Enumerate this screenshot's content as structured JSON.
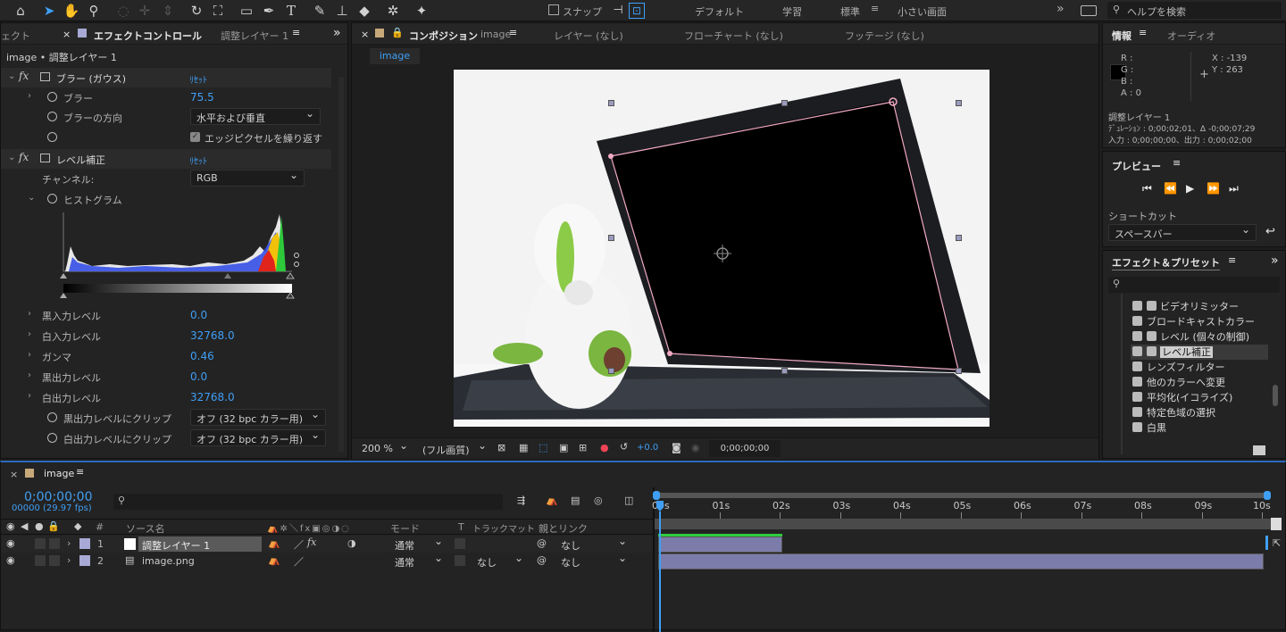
{
  "toolbar": {
    "snap_label": "スナップ",
    "workspaces": [
      "デフォルト",
      "学習",
      "標準",
      "小さい画面"
    ],
    "active_workspace": "標準",
    "help_placeholder": "ヘルプを検索"
  },
  "effect_controls": {
    "left_tab": "ェクト",
    "tab_title": "エフェクトコントロール",
    "tab_layer": "調整レイヤー 1",
    "breadcrumb": "image • 調整レイヤー 1",
    "blur": {
      "name": "ブラー (ガウス)",
      "reset": "ﾘｾｯﾄ",
      "blurriness_label": "ブラー",
      "blurriness_value": "75.5",
      "dimension_label": "ブラーの方向",
      "dimension_value": "水平および垂直",
      "repeat_edge_label": "エッジピクセルを繰り返す"
    },
    "levels": {
      "name": "レベル補正",
      "reset": "ﾘｾｯﾄ",
      "channel_label": "チャンネル:",
      "channel_value": "RGB",
      "histogram_label": "ヒストグラム",
      "input_black_label": "黒入力レベル",
      "input_black_value": "0.0",
      "input_white_label": "白入力レベル",
      "input_white_value": "32768.0",
      "gamma_label": "ガンマ",
      "gamma_value": "0.46",
      "output_black_label": "黒出力レベル",
      "output_black_value": "0.0",
      "output_white_label": "白出力レベル",
      "output_white_value": "32768.0",
      "clip_black_label": "黒出力レベルにクリップ",
      "clip_black_value": "オフ (32 bpc カラー用)",
      "clip_white_label": "白出力レベルにクリップ",
      "clip_white_value": "オフ (32 bpc カラー用)"
    }
  },
  "composition": {
    "tab_title": "コンポジション",
    "tab_comp": "image",
    "other_tabs": [
      "レイヤー (なし)",
      "フローチャート (なし)",
      "フッテージ (なし)"
    ],
    "comp_chip": "image",
    "zoom": "200 %",
    "quality": "(フル画質)",
    "exposure": "+0.0",
    "timecode": "0;00;00;00"
  },
  "info": {
    "tab": "情報",
    "audio_tab": "オーディオ",
    "r": "R :",
    "g": "G :",
    "b": "B :",
    "a": "A : 0",
    "x": "X : -139",
    "y": "Y : 263",
    "layer": "調整レイヤー 1",
    "duration": "ﾃﾞｭﾚｰｼｮﾝ : 0;00;02;01、Δ -0;00;07;29",
    "in_out": "入力 : 0;00;00;00、出力 : 0;00;02;00"
  },
  "preview": {
    "title": "プレビュー",
    "shortcut_label": "ショートカット",
    "shortcut_value": "スペースバー"
  },
  "effects_presets": {
    "title": "エフェクト＆プリセット",
    "search_placeholder": "",
    "items": [
      "ビデオリミッター",
      "ブロードキャストカラー",
      "レベル (個々の制御)",
      "レベル補正",
      "レンズフィルター",
      "他のカラーへ変更",
      "平均化(イコライズ)",
      "特定色域の選択",
      "白黒"
    ],
    "selected_index": 3
  },
  "timeline": {
    "comp_name": "image",
    "timecode": "0;00;00;00",
    "frame_info": "00000 (29.97 fps)",
    "headers": {
      "hash": "#",
      "source_name": "ソース名",
      "mode": "モード",
      "t": "T",
      "track_matte": "トラックマット",
      "parent": "親とリンク"
    },
    "ruler": [
      "00s",
      "01s",
      "02s",
      "03s",
      "04s",
      "05s",
      "06s",
      "07s",
      "08s",
      "09s",
      "10s"
    ],
    "layers": [
      {
        "num": "1",
        "name": "調整レイヤー 1",
        "mode": "通常",
        "matte": "",
        "parent": "なし",
        "bar_end_fraction": 0.205
      },
      {
        "num": "2",
        "name": "image.png",
        "mode": "通常",
        "matte": "なし",
        "parent": "なし",
        "bar_end_fraction": 1.0
      }
    ]
  },
  "colors": {
    "accent": "#3f9ff5",
    "layer_label": "#a9a9d6",
    "selection_path": "#f2aac4"
  }
}
